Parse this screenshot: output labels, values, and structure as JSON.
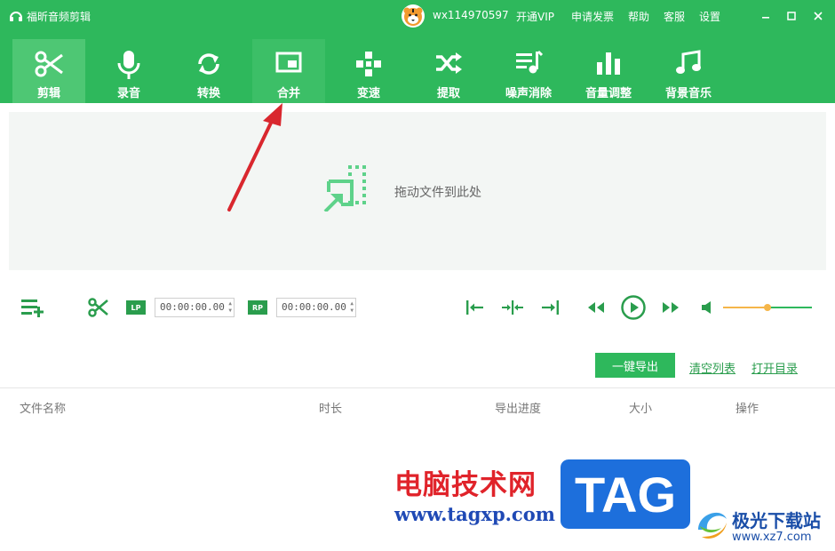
{
  "app": {
    "title": "福昕音频剪辑"
  },
  "titlebar": {
    "user_id": "wx114970597",
    "links": [
      "开通VIP",
      "申请发票",
      "帮助",
      "客服",
      "设置"
    ]
  },
  "tools": [
    {
      "label": "剪辑",
      "icon": "scissors-icon",
      "state": "active"
    },
    {
      "label": "录音",
      "icon": "microphone-icon"
    },
    {
      "label": "转换",
      "icon": "convert-icon"
    },
    {
      "label": "合并",
      "icon": "merge-icon",
      "state": "hover"
    },
    {
      "label": "变速",
      "icon": "speed-icon"
    },
    {
      "label": "提取",
      "icon": "extract-icon"
    },
    {
      "label": "噪声消除",
      "icon": "noise-removal-icon"
    },
    {
      "label": "音量调整",
      "icon": "volume-adjust-icon"
    },
    {
      "label": "背景音乐",
      "icon": "music-note-icon"
    }
  ],
  "dropzone": {
    "text": "拖动文件到此处"
  },
  "controls": {
    "lp_label": "LP",
    "rp_label": "RP",
    "lp_time": "00:00:00.00",
    "rp_time": "00:00:00.00",
    "volume_level": 0.5
  },
  "actions": {
    "export": "一键导出",
    "clear": "清空列表",
    "open_dir": "打开目录"
  },
  "table": {
    "columns": [
      "文件名称",
      "时长",
      "导出进度",
      "大小",
      "操作"
    ],
    "rows": []
  },
  "watermark": {
    "cn": "电脑技术网",
    "url": "www.tagxp.com",
    "tag": "TAG",
    "site_cn": "极光下载站",
    "site_url": "www.xz7.com"
  },
  "colors": {
    "brand_green": "#2eb85c",
    "active_tab": "#4ec774",
    "accent_orange": "#f5b64a",
    "annotation_red": "#d9272e"
  }
}
